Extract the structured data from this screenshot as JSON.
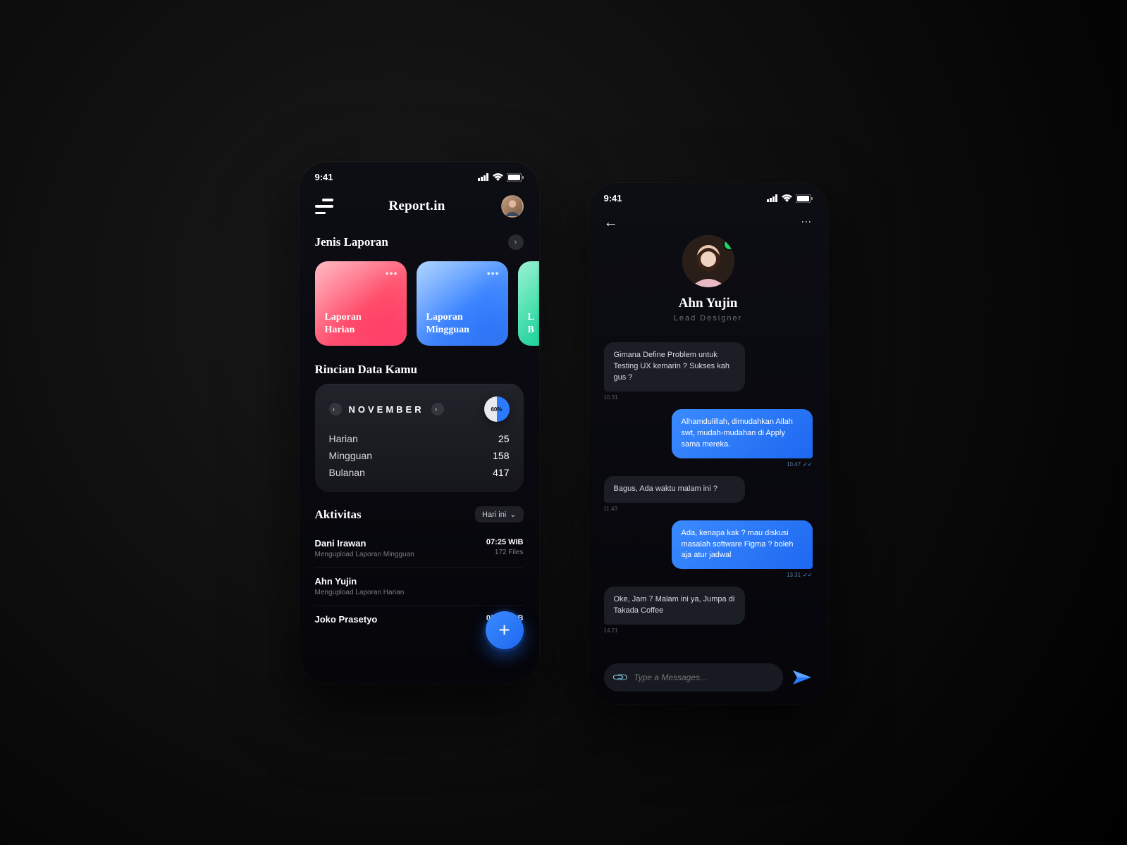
{
  "status_time": "9:41",
  "left": {
    "brand": "Report.in",
    "section_jenis": "Jenis Laporan",
    "cards": [
      {
        "label_l1": "Laporan",
        "label_l2": "Harian"
      },
      {
        "label_l1": "Laporan",
        "label_l2": "Mingguan"
      },
      {
        "label_l1": "L",
        "label_l2": "B"
      }
    ],
    "section_rincian": "Rincian Data Kamu",
    "month": "NOVEMBER",
    "pie_pct": "60%",
    "rows": [
      {
        "label": "Harian",
        "value": "25"
      },
      {
        "label": "Mingguan",
        "value": "158"
      },
      {
        "label": "Bulanan",
        "value": "417"
      }
    ],
    "section_aktivitas": "Aktivitas",
    "filter_label": "Hari ini",
    "activities": [
      {
        "name": "Dani Irawan",
        "sub": "Mengupload Laporan Mingguan",
        "time": "07:25 WIB",
        "files": "172 Files"
      },
      {
        "name": "Ahn Yujin",
        "sub": "Mengupload Laporan Harian",
        "time": "",
        "files": ""
      },
      {
        "name": "Joko Prasetyo",
        "sub": "",
        "time": "03:47 WIB",
        "files": ""
      }
    ]
  },
  "right": {
    "profile_name": "Ahn Yujin",
    "profile_role": "Lead Designer",
    "messages": [
      {
        "side": "in",
        "text": "Gimana Define Problem untuk Testing UX kemarin ? Sukses kah gus ?",
        "time": "10.31"
      },
      {
        "side": "out",
        "text": "Alhamdulillah, dimudahkan Allah swt, mudah-mudahan di Apply sama mereka.",
        "time": "10.47"
      },
      {
        "side": "in",
        "text": "Bagus, Ada waktu malam ini ?",
        "time": "11.43"
      },
      {
        "side": "out",
        "text": "Ada, kenapa kak ? mau diskusi masalah software Figma ? boleh aja atur jadwal",
        "time": "13.31"
      },
      {
        "side": "in",
        "text": "Oke, Jam 7 Malam ini ya, Jumpa di Takada Coffee",
        "time": "14.21"
      }
    ],
    "input_placeholder": "Type a Messages..."
  }
}
